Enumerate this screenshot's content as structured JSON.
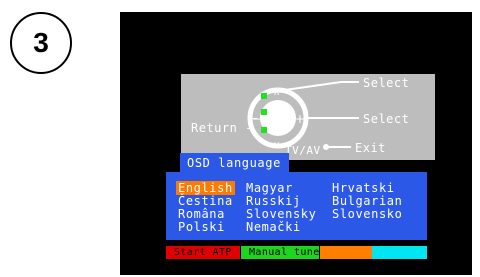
{
  "step": {
    "number": "3"
  },
  "remote": {
    "return_label": "Return -",
    "select_up_label": "Select",
    "select_right_label": "Select",
    "exit_label": "Exit",
    "tvav_label": "TV/AV"
  },
  "osd": {
    "title": "OSD language",
    "languages": {
      "col1": [
        "English",
        "Čestina",
        "Româna",
        "Polski"
      ],
      "col2": [
        "Magyar",
        "Russkij",
        "Slovensky",
        "Nemački"
      ],
      "col3": [
        "Hrvatski",
        "Bulgarian",
        "Slovensko"
      ]
    },
    "selected": "English"
  },
  "function_bar": {
    "red_label": "Start ATP",
    "green_label": "Manual tune",
    "yellow_label": "",
    "cyan_label": ""
  },
  "colors": {
    "osd_blue": "#2b58e6",
    "highlight_orange": "#ff7a00",
    "red": "#e00000",
    "green": "#1dd51d",
    "orange": "#ff7f00",
    "cyan": "#00e6f0"
  }
}
